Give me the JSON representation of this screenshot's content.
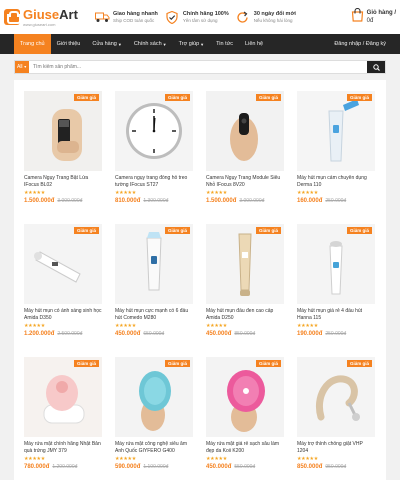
{
  "header": {
    "logo_text_a": "Giuse",
    "logo_text_b": "Art",
    "logo_sub": "www.giuseart.com",
    "features": [
      {
        "icon": "truck-icon",
        "title": "Giao hàng nhanh",
        "sub": "Ship COD toàn quốc"
      },
      {
        "icon": "shield-check-icon",
        "title": "Chính hãng 100%",
        "sub": "Yên tâm sử dụng"
      },
      {
        "icon": "refresh-icon",
        "title": "30 ngày đổi mới",
        "sub": "Nếu không hài lòng"
      }
    ],
    "cart_title": "Giỏ hàng /",
    "cart_total": "0đ"
  },
  "nav": {
    "items": [
      "Trang chủ",
      "Giới thiệu",
      "Cửa hàng",
      "Chính sách",
      "Trợ giúp",
      "Tin tức",
      "Liên hệ"
    ],
    "has_caret": [
      false,
      false,
      true,
      true,
      true,
      false,
      false
    ],
    "login": "Đăng nhập / Đăng ký"
  },
  "search": {
    "category": "All",
    "placeholder": "Tìm kiếm sản phẩm..."
  },
  "colors": {
    "accent": "#f58220",
    "nav_bg": "#262626",
    "star": "#f5a623"
  },
  "products": [
    {
      "name": "Camera Ngụy Trang Bật Lửa IFocus BL02",
      "price": "1.500.000đ",
      "old": "3.000.000đ",
      "badge": "Giảm giá",
      "rating": 5
    },
    {
      "name": "Camera ngụy trang đồng hồ treo tường IFocus ST27",
      "price": "810.000đ",
      "old": "1.300.000đ",
      "badge": "Giảm giá",
      "rating": 5
    },
    {
      "name": "Camera Ngụy Trang Module Siêu Nhỏ IFocus 8V20",
      "price": "1.500.000đ",
      "old": "3.000.000đ",
      "badge": "Giảm giá",
      "rating": 5
    },
    {
      "name": "Máy hút mụn cám chuyên dụng Derma 110",
      "price": "160.000đ",
      "old": "250.000đ",
      "badge": "Giảm giá",
      "rating": 5
    },
    {
      "name": "Máy hút mụn có ánh sáng sinh học Amida D350",
      "price": "1.200.000đ",
      "old": "2.500.000đ",
      "badge": "Giảm giá",
      "rating": 5
    },
    {
      "name": "Máy hút mụn cực mạnh có 6 đầu hút Comedo M280",
      "price": "450.000đ",
      "old": "650.000đ",
      "badge": "Giảm giá",
      "rating": 5
    },
    {
      "name": "Máy hút mụn đầu đen cao cấp Amida D250",
      "price": "450.000đ",
      "old": "850.000đ",
      "badge": "Giảm giá",
      "rating": 5
    },
    {
      "name": "Máy hút mụn giá rẻ 4 đầu hút Hanna 115",
      "price": "190.000đ",
      "old": "250.000đ",
      "badge": "Giảm giá",
      "rating": 5
    },
    {
      "name": "Máy rửa mặt chính hãng Nhật Bản quà trứng JMY 379",
      "price": "780.000đ",
      "old": "1.200.000đ",
      "badge": "Giảm giá",
      "rating": 5
    },
    {
      "name": "Máy rửa mặt công nghệ siêu âm Anh Quốc GIYFERO G400",
      "price": "590.000đ",
      "old": "1.100.000đ",
      "badge": "Giảm giá",
      "rating": 5
    },
    {
      "name": "Máy rửa mặt giá rẻ sạch sâu làm đẹp da Koii K200",
      "price": "450.000đ",
      "old": "550.000đ",
      "badge": "Giảm giá",
      "rating": 5
    },
    {
      "name": "Máy trợ thính chống giật VHP 1204",
      "price": "850.000đ",
      "old": "950.000đ",
      "badge": "Giảm giá",
      "rating": 5
    }
  ]
}
